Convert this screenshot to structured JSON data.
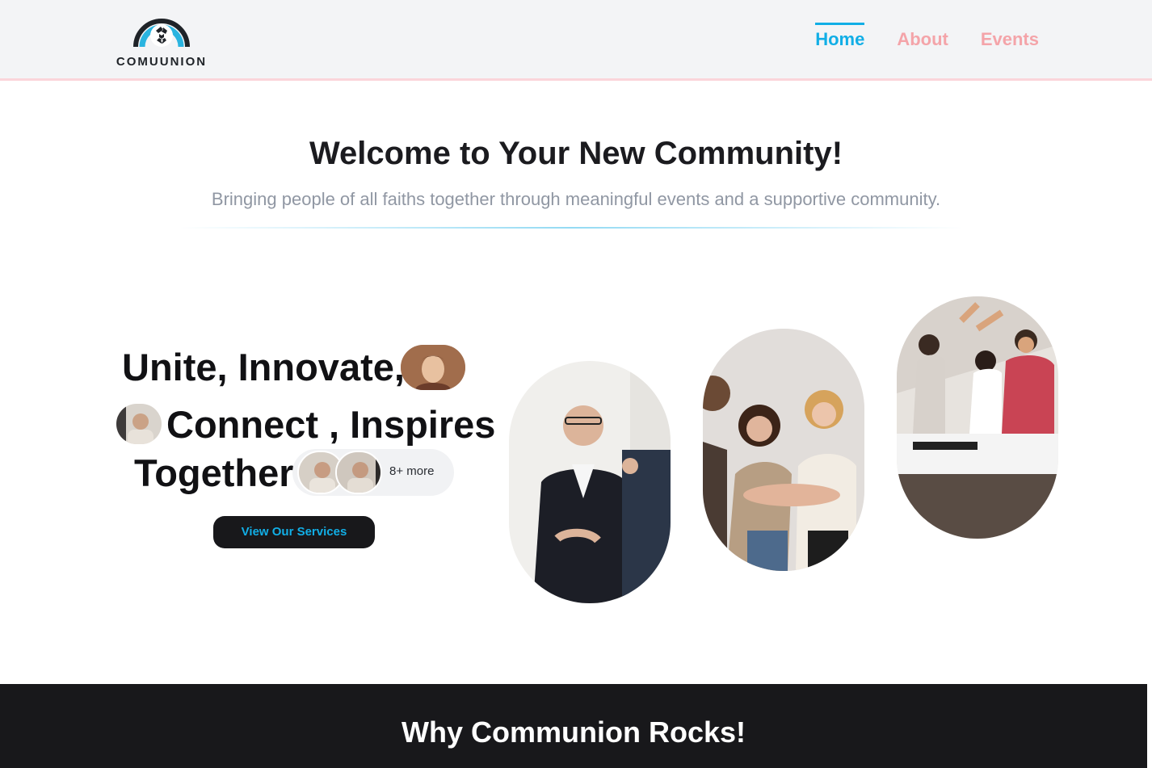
{
  "header": {
    "logo_text": "COMUUNION",
    "nav": [
      {
        "label": "Home",
        "active": true
      },
      {
        "label": "About",
        "active": false
      },
      {
        "label": "Events",
        "active": false
      }
    ]
  },
  "welcome": {
    "title": "Welcome to Your New Community!",
    "subtitle": "Bringing people of all faiths together through meaningful events and a supportive community."
  },
  "hero": {
    "line1": "Unite, Innovate,",
    "line2": "Connect , Inspires",
    "line3": "Together",
    "more_label": "8+ more",
    "cta_label": "View Our Services"
  },
  "images": [
    {
      "name": "businessman-photo"
    },
    {
      "name": "team-hands-photo"
    },
    {
      "name": "office-celebration-photo"
    }
  ],
  "section2": {
    "title": "Why Communion Rocks!"
  },
  "colors": {
    "accent": "#11aee6",
    "nav_inactive": "#f4a4a9",
    "dark": "#18181b",
    "header_bg": "#f3f4f6"
  }
}
